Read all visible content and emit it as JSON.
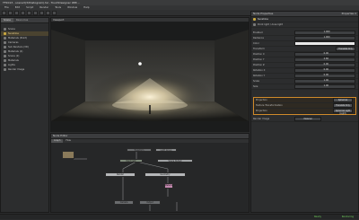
{
  "window": {
    "title": "TF2013 - scene3(3dhistogram).tsl - TouchDesigner 088 ..."
  },
  "menu": [
    "File",
    "Edit",
    "Script",
    "Render",
    "Tools",
    "Window",
    "Help"
  ],
  "left_panel": {
    "tabs": [
      "Scene",
      "Resources"
    ],
    "items": [
      {
        "label": "Scene",
        "selected": false,
        "icon": "cube-icon"
      },
      {
        "label": "Sunshine",
        "selected": true,
        "icon": "light-icon"
      },
      {
        "label": "Materials (Point)",
        "selected": false,
        "icon": "material-icon"
      },
      {
        "label": "Cameras",
        "selected": false,
        "icon": "camera-icon"
      },
      {
        "label": "Sub Renders (3D)",
        "selected": false,
        "icon": "render-icon"
      },
      {
        "label": "Materials (2)",
        "selected": false,
        "icon": "material-icon"
      },
      {
        "label": "Scene (2)",
        "selected": false,
        "icon": "cube-icon"
      },
      {
        "label": "Materials",
        "selected": false,
        "icon": "material-icon"
      },
      {
        "label": "Lights",
        "selected": false,
        "icon": "light-icon"
      },
      {
        "label": "Render Image",
        "selected": false,
        "icon": "image-icon"
      }
    ]
  },
  "viewport": {
    "label": "Viewport"
  },
  "node_editor": {
    "title": "Node Editor",
    "tabs": [
      "Graph",
      "Flow"
    ],
    "nodes": [
      {
        "label": "Transform"
      },
      {
        "label": "Light Group"
      },
      {
        "label": "Point light"
      },
      {
        "label": "Scene Output"
      },
      {
        "label": "Render"
      },
      {
        "label": "Geometry"
      },
      {
        "label": "Material"
      },
      {
        "label": "Camera"
      },
      {
        "label": "Output"
      }
    ]
  },
  "properties": {
    "title": "Node Properties",
    "header_right": "Properties ▾",
    "sub1": "Sunshine",
    "sub2": "Point light / Area light",
    "rows": [
      {
        "label": "Enabled",
        "value": "1.000",
        "type": "slider"
      },
      {
        "label": "Radiance",
        "value": "1.000",
        "type": "slider"
      },
      {
        "label": "Color",
        "value": "",
        "type": "color"
      },
      {
        "label": "Transform",
        "value": "Translate Only",
        "type": "button"
      },
      {
        "label": "Position X",
        "value": "0.00",
        "type": "slider"
      },
      {
        "label": "Position Y",
        "value": "2.60",
        "type": "slider"
      },
      {
        "label": "Position Z",
        "value": "0.00",
        "type": "slider"
      },
      {
        "label": "Rotation X",
        "value": "0.00",
        "type": "slider"
      },
      {
        "label": "Rotation Y",
        "value": "0.00",
        "type": "slider"
      },
      {
        "label": "Scale",
        "value": "1.00",
        "type": "slider"
      },
      {
        "label": "Size",
        "value": "1.00",
        "type": "slider"
      }
    ],
    "highlight_rows": [
      {
        "label": "Projection",
        "value": "Spherical",
        "type": "button"
      },
      {
        "label": "Texture Transformation",
        "value": "Translate Only",
        "type": "button"
      },
      {
        "label": "Projection",
        "value": "Spherical Light (Light)",
        "type": "button"
      }
    ],
    "footer_row": {
      "label": "Render Image",
      "value": "Material"
    }
  },
  "statusbar": {
    "left": "",
    "right1": "Ready",
    "right2": "Rendering"
  }
}
